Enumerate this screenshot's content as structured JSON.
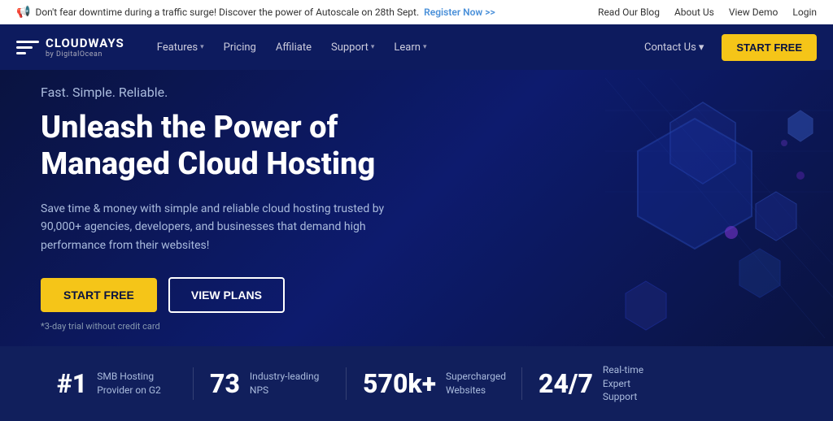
{
  "announcement": {
    "icon": "📢",
    "text": "Don't fear downtime during a traffic surge! Discover the power of Autoscale on 28th Sept.",
    "register_link": "Register Now >>",
    "right_links": [
      {
        "label": "Read Our Blog",
        "name": "read-blog-link"
      },
      {
        "label": "About Us",
        "name": "about-us-link"
      },
      {
        "label": "View Demo",
        "name": "view-demo-link"
      },
      {
        "label": "Login",
        "name": "login-link"
      }
    ]
  },
  "nav": {
    "logo_brand": "CLOUDWAYS",
    "logo_sub": "by DigitalOcean",
    "links": [
      {
        "label": "Features",
        "has_dropdown": true,
        "name": "features-nav"
      },
      {
        "label": "Pricing",
        "has_dropdown": false,
        "name": "pricing-nav"
      },
      {
        "label": "Affiliate",
        "has_dropdown": false,
        "name": "affiliate-nav"
      },
      {
        "label": "Support",
        "has_dropdown": true,
        "name": "support-nav"
      },
      {
        "label": "Learn",
        "has_dropdown": true,
        "name": "learn-nav"
      }
    ],
    "contact_us": "Contact Us",
    "start_free": "START FREE"
  },
  "hero": {
    "tagline": "Fast. Simple. Reliable.",
    "title_line1": "Unleash the Power of",
    "title_line2": "Managed Cloud Hosting",
    "description": "Save time & money with simple and reliable cloud hosting trusted by 90,000+ agencies, developers, and businesses that demand high performance from their websites!",
    "btn_start": "START FREE",
    "btn_plans": "VIEW PLANS",
    "trial_note": "*3-day trial without credit card"
  },
  "stats": [
    {
      "number": "#1",
      "label": "SMB Hosting Provider on G2"
    },
    {
      "number": "73",
      "label": "Industry-leading NPS"
    },
    {
      "number": "570k+",
      "label": "Supercharged Websites"
    },
    {
      "number": "24/7",
      "label": "Real-time Expert Support"
    }
  ],
  "colors": {
    "accent_yellow": "#f5c518",
    "nav_bg": "#0d1b5e",
    "hero_bg": "#0a1340",
    "stats_bg": "#111f5c"
  }
}
